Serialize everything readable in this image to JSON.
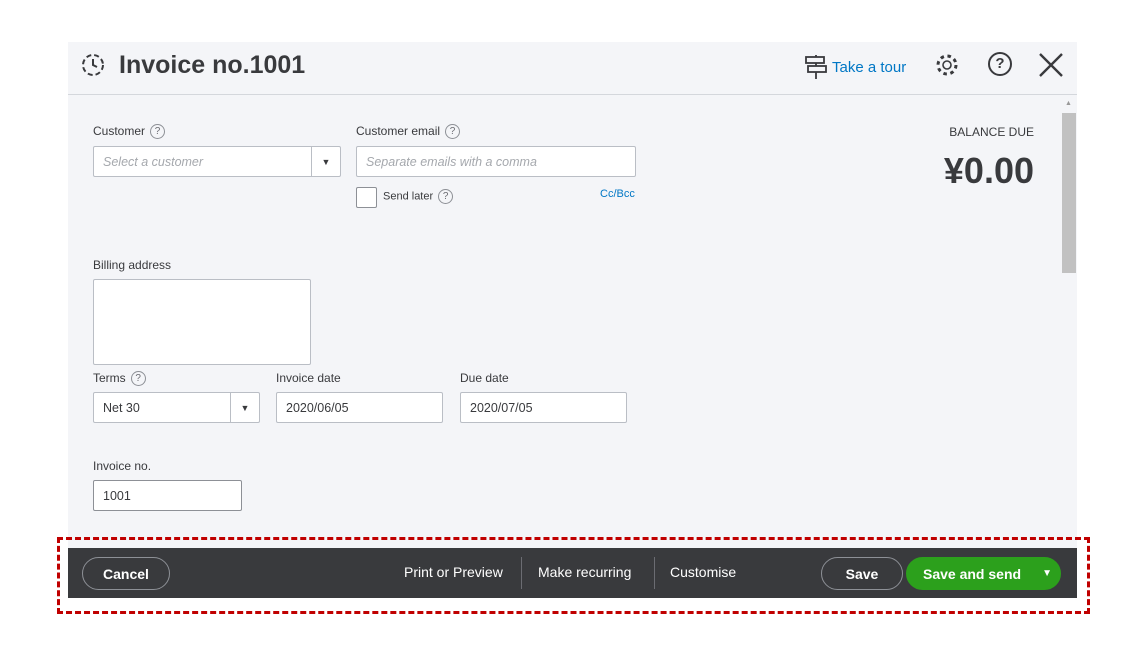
{
  "header": {
    "title": "Invoice no.1001",
    "tour_label": "Take a tour",
    "icons": [
      "recurring-clock-icon",
      "signpost-icon",
      "gear-icon",
      "help-icon",
      "close-icon"
    ]
  },
  "form": {
    "customer": {
      "label": "Customer",
      "placeholder": "Select a customer"
    },
    "customer_email": {
      "label": "Customer email",
      "placeholder": "Separate emails with a comma"
    },
    "send_later": {
      "label": "Send later",
      "checked": false
    },
    "cc_bcc": "Cc/Bcc",
    "billing_address": {
      "label": "Billing address",
      "value": ""
    },
    "terms": {
      "label": "Terms",
      "value": "Net 30"
    },
    "invoice_date": {
      "label": "Invoice date",
      "value": "2020/06/05"
    },
    "due_date": {
      "label": "Due date",
      "value": "2020/07/05"
    },
    "invoice_no": {
      "label": "Invoice no.",
      "value": "1001"
    }
  },
  "balance": {
    "label": "BALANCE DUE",
    "amount": "¥0.00"
  },
  "footer": {
    "cancel": "Cancel",
    "print": "Print or Preview",
    "recurring": "Make recurring",
    "customise": "Customise",
    "save": "Save",
    "save_send": "Save and send"
  },
  "colors": {
    "accent_link": "#0077c5",
    "primary_green": "#2ca01c",
    "footer_bg": "#393a3d",
    "highlight": "#c00000"
  }
}
